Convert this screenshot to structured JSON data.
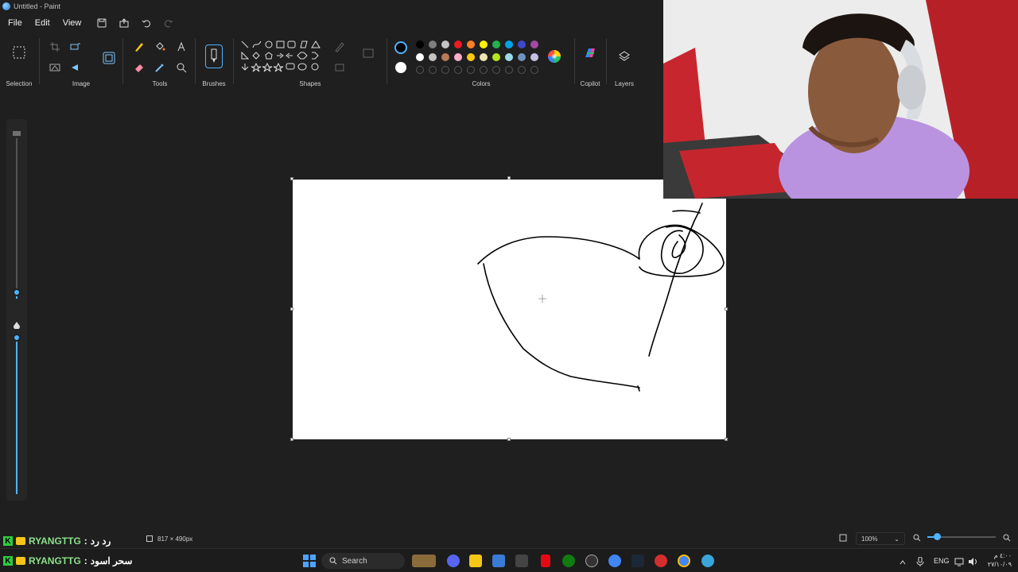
{
  "window": {
    "title": "Untitled - Paint"
  },
  "menu": {
    "file": "File",
    "edit": "Edit",
    "view": "View"
  },
  "ribbon": {
    "selection": "Selection",
    "image": "Image",
    "tools": "Tools",
    "brushes": "Brushes",
    "shapes": "Shapes",
    "colors": "Colors",
    "copilot": "Copilot",
    "layers": "Layers"
  },
  "palette": {
    "primary": "#000000",
    "secondary": "#ffffff",
    "row1": [
      "#000000",
      "#7f7f7f",
      "#c3c3c3",
      "#ed1c24",
      "#ff7f27",
      "#fff200",
      "#22b14c",
      "#00a2e8",
      "#3f48cc",
      "#a349a4"
    ],
    "row2": [
      "#ffffff",
      "#c3c3c3",
      "#b97a57",
      "#ffaec9",
      "#ffc90e",
      "#efe4b0",
      "#b5e61d",
      "#99d9ea",
      "#7092be",
      "#c8bfe7"
    ]
  },
  "status": {
    "canvas_size": "817 × 490px",
    "zoom": "100%"
  },
  "chat": [
    {
      "user": "RYANGTTG",
      "message": "رد رد"
    },
    {
      "user": "RYANGTTG",
      "message": "سحر اسود"
    }
  ],
  "taskbar": {
    "search_placeholder": "Search",
    "lang": "ENG",
    "time": "٤:٠٠ م",
    "date": "٢٧/١٠/٠٩"
  }
}
